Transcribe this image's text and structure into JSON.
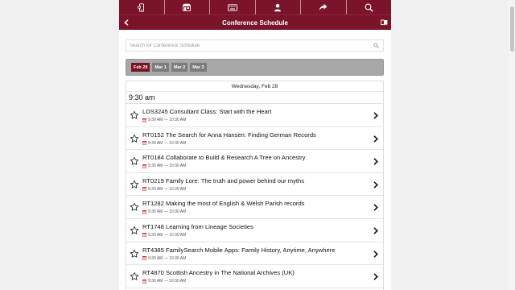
{
  "nav": {
    "icons": [
      "phone-icon",
      "store-icon",
      "keyboard-icon",
      "user-icon",
      "share-icon",
      "search-icon"
    ]
  },
  "header": {
    "title": "Conference Schedule"
  },
  "search": {
    "placeholder": "Search for Conference Schedule"
  },
  "tabs": [
    {
      "label": "Feb 28",
      "active": true
    },
    {
      "label": "Mar 1",
      "active": false
    },
    {
      "label": "Mar 2",
      "active": false
    },
    {
      "label": "Mar 3",
      "active": false
    }
  ],
  "schedule": {
    "day": "Wednesday, Feb 28",
    "time_header": "9:30 am",
    "sessions": [
      {
        "title": "LDS3245 Consultant Class: Start with the Heart",
        "time": "9:30 AM — 10:30 AM"
      },
      {
        "title": "RT0152 The Search for Anna Hansen: Finding German Records",
        "time": "9:30 AM — 10:30 AM"
      },
      {
        "title": "RT0184 Collaborate to Build & Research A Tree on Ancestry",
        "time": "9:30 AM — 10:30 AM"
      },
      {
        "title": "RT0219 Family Lore: The truth and power behind our myths",
        "time": "9:30 AM — 10:30 AM"
      },
      {
        "title": "RT1282 Making the most of English & Welsh Parish records",
        "time": "9:30 AM — 10:30 AM"
      },
      {
        "title": "RT1748 Learning from Lineage Societies",
        "time": "9:30 AM — 10:30 AM"
      },
      {
        "title": "RT4385 FamilySearch Mobile Apps: Family History, Anytime, Anywhere",
        "time": "9:30 AM — 10:30 AM"
      },
      {
        "title": "RT4870 Scottish Ancestry in The National Archives (UK)",
        "time": "9:30 AM — 10:30 AM"
      }
    ]
  },
  "colors": {
    "brand": "#7a1428",
    "tab_inactive": "#7c7c7c",
    "tabbar": "#a8a8a8"
  }
}
